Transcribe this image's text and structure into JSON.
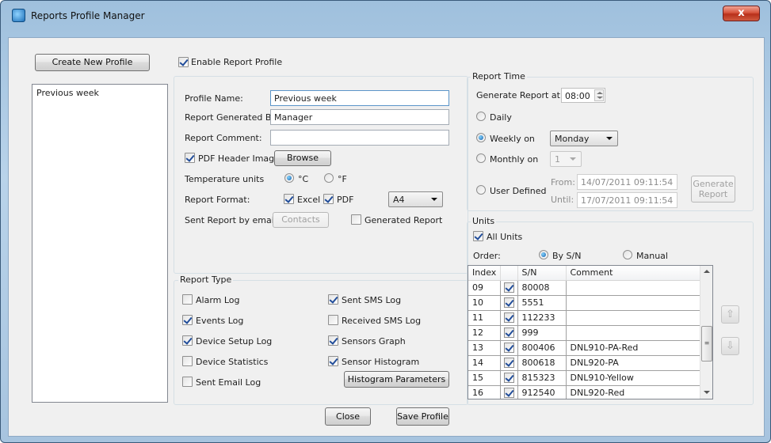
{
  "window": {
    "title": "Reports Profile Manager",
    "close_glyph": "x"
  },
  "left": {
    "create_button": "Create New Profile",
    "profiles": [
      "Previous week"
    ]
  },
  "profile": {
    "enable_label": "Enable Report Profile",
    "name_label": "Profile Name:",
    "name_value": "Previous week",
    "generated_by_label": "Report Generated By:",
    "generated_by_value": "Manager",
    "comment_label": "Report Comment:",
    "comment_value": "",
    "pdf_header_label": "PDF Header Image",
    "browse_button": "Browse",
    "temp_units_label": "Temperature units",
    "celsius_label": "°C",
    "fahrenheit_label": "°F",
    "format_label": "Report Format:",
    "excel_label": "Excel",
    "pdf_label": "PDF",
    "page_size": "A4",
    "email_label": "Sent Report by email",
    "contacts_button": "Contacts",
    "generated_report_label": "Generated Report"
  },
  "report_type": {
    "title": "Report Type",
    "items": [
      {
        "label": "Alarm Log",
        "checked": false
      },
      {
        "label": "Sent SMS Log",
        "checked": true
      },
      {
        "label": "Events Log",
        "checked": true
      },
      {
        "label": "Received SMS Log",
        "checked": false
      },
      {
        "label": "Device Setup Log",
        "checked": true
      },
      {
        "label": "Sensors Graph",
        "checked": true
      },
      {
        "label": "Device Statistics",
        "checked": false
      },
      {
        "label": "Sensor Histogram",
        "checked": true
      },
      {
        "label": "Sent Email Log",
        "checked": false
      }
    ],
    "histogram_button": "Histogram Parameters"
  },
  "report_time": {
    "title": "Report Time",
    "generate_at_label": "Generate Report at",
    "time_value": "08:00",
    "daily_label": "Daily",
    "weekly_label": "Weekly on",
    "weekly_value": "Monday",
    "monthly_label": "Monthly on",
    "monthly_value": "1",
    "user_defined_label": "User Defined",
    "from_label": "From:",
    "from_value": "14/07/2011 09:11:54",
    "until_label": "Until:",
    "until_value": "17/07/2011 09:11:54",
    "generate_button": "Generate Report"
  },
  "units": {
    "title": "Units",
    "all_units_label": "All Units",
    "order_label": "Order:",
    "by_sn_label": "By S/N",
    "manual_label": "Manual",
    "columns": [
      "Index",
      "",
      "S/N",
      "Comment"
    ],
    "rows": [
      {
        "index": "09",
        "sn": "80008",
        "comment": ""
      },
      {
        "index": "10",
        "sn": "5551",
        "comment": ""
      },
      {
        "index": "11",
        "sn": "112233",
        "comment": ""
      },
      {
        "index": "12",
        "sn": "999",
        "comment": ""
      },
      {
        "index": "13",
        "sn": "800406",
        "comment": "DNL910-PA-Red"
      },
      {
        "index": "14",
        "sn": "800618",
        "comment": "DNL920-PA"
      },
      {
        "index": "15",
        "sn": "815323",
        "comment": "DNL910-Yellow"
      },
      {
        "index": "16",
        "sn": "912540",
        "comment": "DNL920-Red"
      }
    ],
    "move_up_icon": "up-arrow-icon",
    "move_down_icon": "down-arrow-icon"
  },
  "footer": {
    "close_button": "Close",
    "save_button": "Save Profile"
  }
}
